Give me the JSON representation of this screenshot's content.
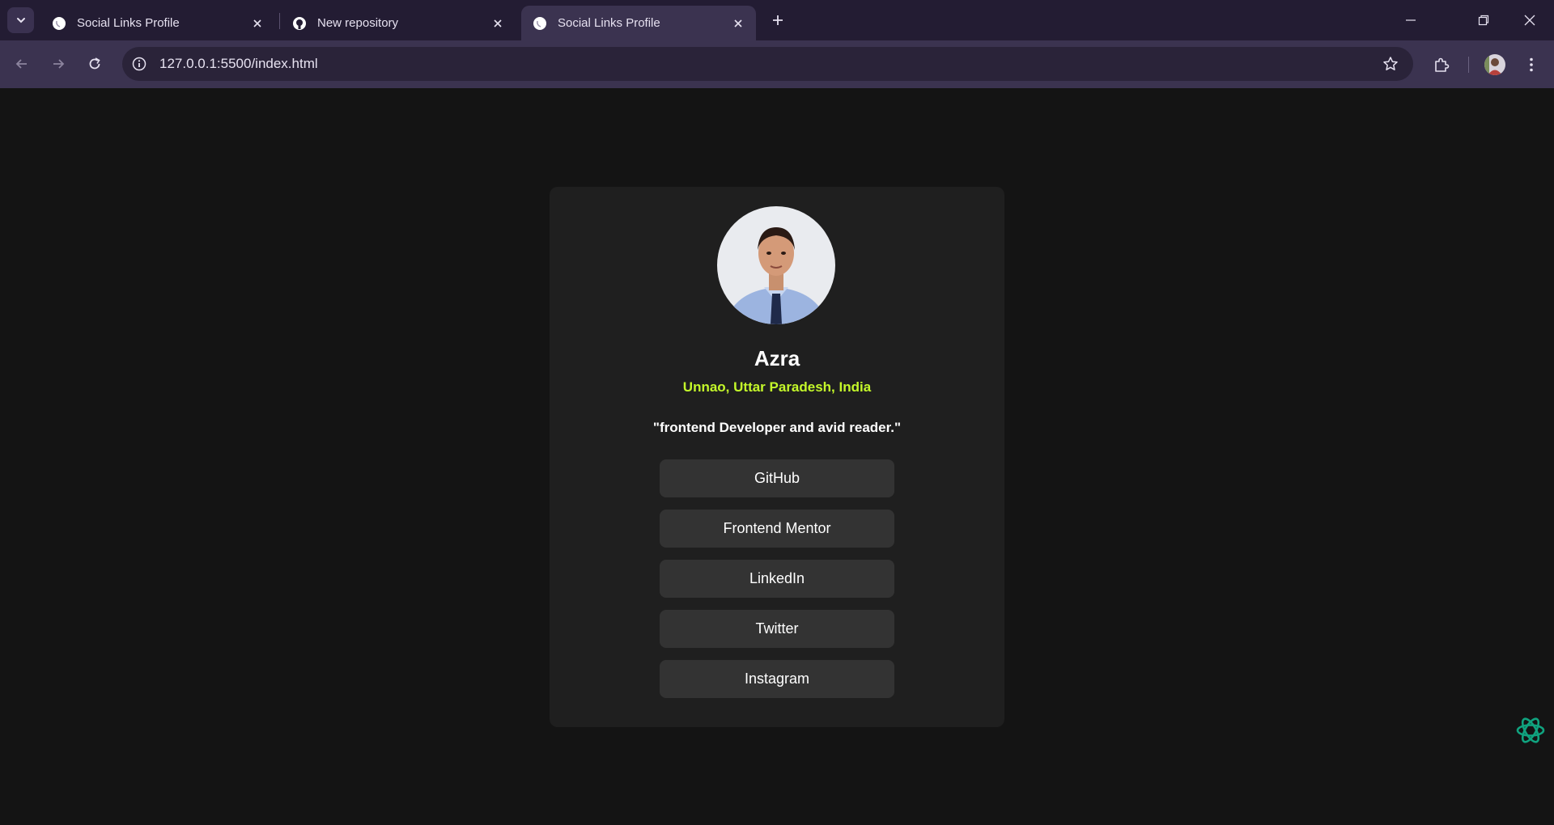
{
  "browser": {
    "tabs": [
      {
        "title": "Social Links Profile",
        "favicon": "globe-icon",
        "active": false
      },
      {
        "title": "New repository",
        "favicon": "github-icon",
        "active": false
      },
      {
        "title": "Social Links Profile",
        "favicon": "globe-icon",
        "active": true
      }
    ],
    "address_bar": {
      "url": "127.0.0.1:5500/index.html"
    },
    "colors": {
      "frame": "#231c33",
      "toolbar": "#3b3350",
      "omnibox": "#2a2339"
    }
  },
  "profile": {
    "name": "Azra",
    "location": "Unnao, Uttar Paradesh, India",
    "bio": "\"frontend Developer and avid reader.\"",
    "links": [
      "GitHub",
      "Frontend Mentor",
      "LinkedIn",
      "Twitter",
      "Instagram"
    ]
  },
  "colors": {
    "page_bg": "#141414",
    "card_bg": "#1f1f1f",
    "button_bg": "#333333",
    "accent": "#c4f82a",
    "assistant_icon": "#10a37f"
  }
}
